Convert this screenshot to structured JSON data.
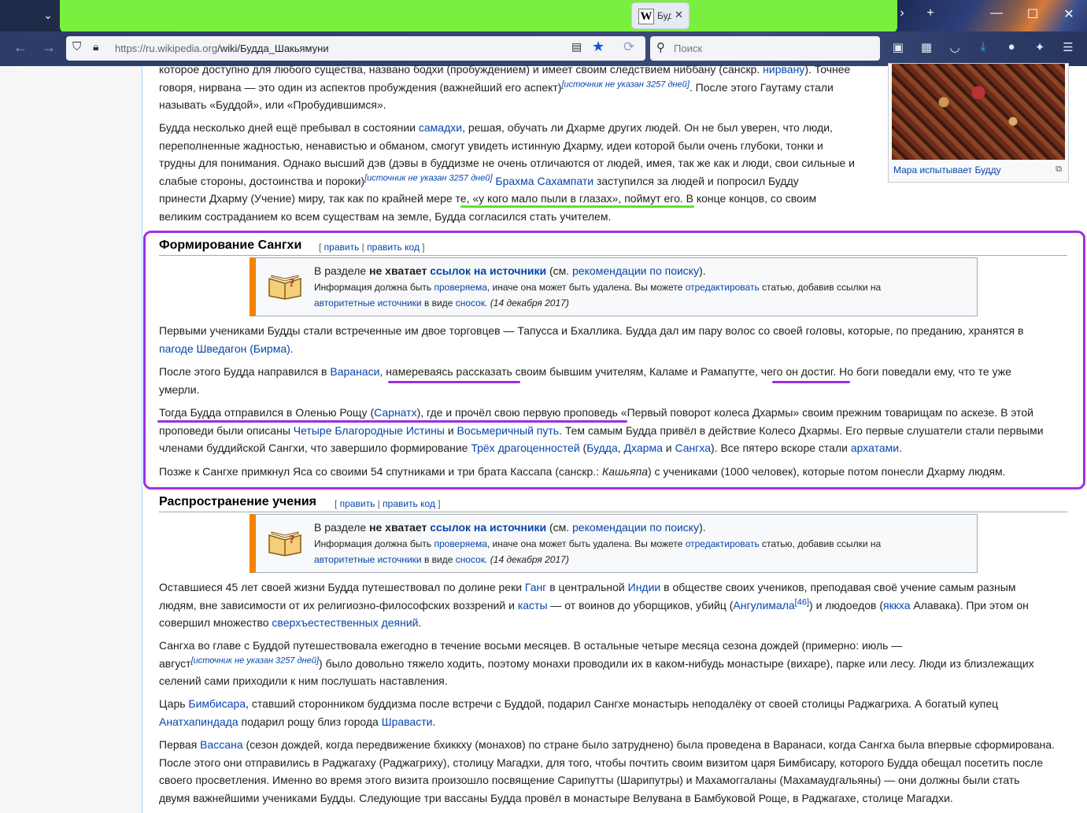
{
  "browser": {
    "tab_title": "Буд",
    "favicon_letter": "W",
    "url_host": "https://ru.wikipedia.org",
    "url_path": "/wiki/Будда_Шакьямуни",
    "search_placeholder": "Поиск"
  },
  "top_paragraphs": {
    "p1_l1_a": "которое доступно для любого существа, названо бодхи (пробуждением) и имеет своим следствием ниббану (санскр. ",
    "p1_l1_link": "нирвану",
    "p1_l1_b": "). Точнее",
    "p1_l2_a": "говоря, нирвана — это один из аспектов пробуждения (важнейший его аспект)",
    "p1_l2_cite": "[источник не указан 3257 дней]",
    "p1_l2_b": ". После этого Гаутаму стали",
    "p1_l3": "называть «Буддой», или «Пробудившимся».",
    "p2_l1_a": "Будда несколько дней ещё пребывал в состоянии ",
    "p2_l1_link": "самадхи",
    "p2_l1_b": ", решая, обучать ли Дхарме других людей. Он не был уверен, что люди,",
    "p2_l2": "переполненные жадностью, ненавистью и обманом, смогут увидеть истинную Дхарму, идеи которой были очень глубоки, тонки и",
    "p2_l3": "трудны для понимания. Однако высший дэв (дэвы в буддизме не очень отличаются от людей, имея, так же как и люди, свои сильные и",
    "p2_l4_a": "слабые стороны, достоинства и пороки)",
    "p2_l4_cite": "[источник не указан 3257 дней]",
    "p2_l4_link": "Брахма Сахампати",
    "p2_l4_b": " заступился за людей и попросил Будду",
    "p2_l5": "принести Дхарму (Учение) миру, так как по крайней мере те, «у кого мало пыли в глазах», поймут его. В конце концов, со своим",
    "p2_l6": "великим состраданием ко всем существам на земле, Будда согласился стать учителем."
  },
  "thumb": {
    "caption": "Мара испытывает Будду"
  },
  "sections": [
    {
      "title": "Формирование Сангхи",
      "edit": "править",
      "edit_code": "править код",
      "ambox": {
        "l1_a": "В разделе ",
        "l1_b": "не хватает ",
        "l1_link": "ссылок на источники",
        "l1_c": " (см. ",
        "l1_link2": "рекомендации по поиску",
        "l1_d": ").",
        "l2_a": "Информация должна быть ",
        "l2_link": "проверяема",
        "l2_b": ", иначе она может быть удалена. Вы можете ",
        "l2_link2": "отредактировать",
        "l2_c": " статью, добавив ссылки на",
        "l3_link": "авторитетные источники",
        "l3_a": " в виде ",
        "l3_link2": "сносок",
        "l3_b": ". (14 декабря 2017)"
      }
    },
    {
      "title": "Распространение учения",
      "edit": "править",
      "edit_code": "править код",
      "ambox": {
        "l1_a": "В разделе ",
        "l1_b": "не хватает ",
        "l1_link": "ссылок на источники",
        "l1_c": " (см. ",
        "l1_link2": "рекомендации по поиску",
        "l1_d": ").",
        "l2_a": "Информация должна быть ",
        "l2_link": "проверяема",
        "l2_b": ", иначе она может быть удалена. Вы можете ",
        "l2_link2": "отредактировать",
        "l2_c": " статью, добавив ссылки на",
        "l3_link": "авторитетные источники",
        "l3_a": " в виде ",
        "l3_link2": "сносок",
        "l3_b": ". (14 декабря 2017)"
      }
    }
  ],
  "sangha": {
    "p1_l1": "Первыми учениками Будды стали встреченные им двое торговцев — Тапусса и Бхаллика. Будда дал им пару волос со своей головы, которые, по преданию, хранятся в",
    "p1_l2_link": "пагоде Шведагон (Бирма)",
    "p1_l2_b": ".",
    "p2_l1_a": "После этого Будда направился в ",
    "p2_l1_link": "Варанаси",
    "p2_l1_b": ", намереваясь рассказать своим бывшим учителям, Каламе и Рамапутте, чего он достиг. Но боги поведали ему, что те уже",
    "p2_l2": "умерли.",
    "p3_l1_a": "Тогда Будда отправился в Оленью Рощу (",
    "p3_l1_link": "Сарнатх",
    "p3_l1_b": "), где и прочёл свою первую проповедь «Первый поворот колеса Дхармы» своим прежним товарищам по аскезе. В этой",
    "p3_l2_a": "проповеди были описаны ",
    "p3_l2_link1": "Четыре Благородные Истины",
    "p3_l2_b": " и ",
    "p3_l2_link2": "Восьмеричный путь",
    "p3_l2_c": ". Тем самым Будда привёл в действие Колесо Дхармы. Его первые слушатели стали первыми",
    "p3_l3_a": "членами буддийской Сангхи, что завершило формирование ",
    "p3_l3_link1": "Трёх драгоценностей",
    "p3_l3_b": " (",
    "p3_l3_link2": "Будда",
    "p3_l3_c": ", ",
    "p3_l3_link3": "Дхарма",
    "p3_l3_d": " и ",
    "p3_l3_link4": "Сангха",
    "p3_l3_e": "). Все пятеро вскоре стали ",
    "p3_l3_link5": "архатами",
    "p3_l3_f": ".",
    "p4_a": "Позже к Сангхе примкнул Яса со своими 54 спутниками и три брата Кассапа (санскр.: ",
    "p4_i": "Кашьяпа",
    "p4_b": ") с учениками (1000 человек), которые потом понесли Дхарму людям."
  },
  "spread": {
    "p1_l1_a": "Оставшиеся 45 лет своей жизни Будда путешествовал по долине реки ",
    "p1_l1_link1": "Ганг",
    "p1_l1_b": " в центральной ",
    "p1_l1_link2": "Индии",
    "p1_l1_c": " в обществе своих учеников, преподавая своё учение самым разным",
    "p1_l2_a": "людям, вне зависимости от их религиозно-философских воззрений и ",
    "p1_l2_link1": "касты",
    "p1_l2_b": " — от воинов до уборщиков, убийц (",
    "p1_l2_link2": "Ангулимала",
    "p1_l2_ref": "[46]",
    "p1_l2_c": ") и людоедов (",
    "p1_l2_link3": "яккха",
    "p1_l2_d": " Алавака). При этом он",
    "p1_l3_a": "совершил множество ",
    "p1_l3_link": "сверхъестественных деяний",
    "p1_l3_b": ".",
    "p2_l1": "Сангха во главе с Буддой путешествовала ежегодно в течение восьми месяцев. В остальные четыре месяца сезона дождей (примерно: июль —",
    "p2_l2_a": "август",
    "p2_l2_cite": "[источник не указан 3257 дней]",
    "p2_l2_b": ") было довольно тяжело ходить, поэтому монахи проводили их в каком-нибудь монастыре (вихаре), парке или лесу. Люди из близлежащих",
    "p2_l3": "селений сами приходили к ним послушать наставления.",
    "p3_l1_a": "Царь ",
    "p3_l1_link": "Бимбисара",
    "p3_l1_b": ", ставший сторонником буддизма после встречи с Буддой, подарил Сангхе монастырь неподалёку от своей столицы Раджагриха. А богатый купец",
    "p3_l2_link1": "Анатхапиндада",
    "p3_l2_a": " подарил рощу близ города ",
    "p3_l2_link2": "Шравасти",
    "p3_l2_b": ".",
    "p4_l1_a": "Первая ",
    "p4_l1_link": "Вассана",
    "p4_l1_b": " (сезон дождей, когда передвижение бхиккху (монахов) по стране было затруднено) была проведена в Варанаси, когда Сангха была впервые сформирована.",
    "p4_l2": "После этого они отправились в Раджагаху (Раджагриху), столицу Магадхи, для того, чтобы почтить своим визитом царя Бимбисару, которого Будда обещал посетить после",
    "p4_l3": "своего просветления. Именно во время этого визита произошло посвящение Сарипутты (Шарипутры) и Махамоггаланы (Махамаудгальяны) — они должны были стать",
    "p4_l4": "двумя важнейшими учениками Будды. Следующие три вассаны Будда провёл в монастыре Велувана в Бамбуковой Роще, в Раджагахе, столице Магадхи."
  },
  "colors": {
    "green_highlight": "#7bef3f",
    "purple_annotation": "#a32ee6",
    "link": "#0645ad",
    "ambox_border": "#f28500"
  }
}
